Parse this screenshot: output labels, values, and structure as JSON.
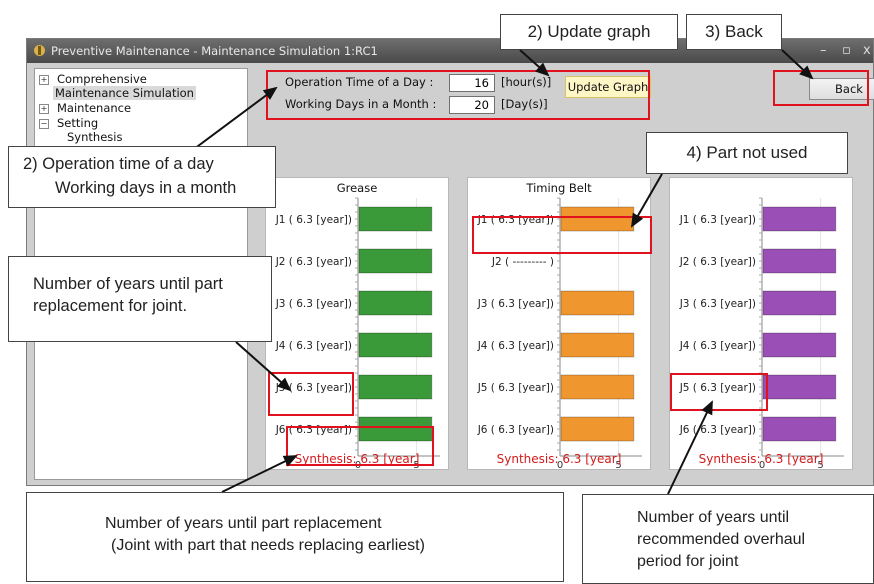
{
  "window": {
    "title": "Preventive Maintenance - Maintenance Simulation 1:RC1",
    "controls": [
      "–",
      "▫",
      "x"
    ]
  },
  "tree": {
    "items": [
      {
        "label": "Comprehensive",
        "expand": "+"
      },
      {
        "label": "Maintenance Simulation"
      },
      {
        "label": "Maintenance",
        "expand": "+"
      },
      {
        "label": "Setting",
        "expand": "−"
      },
      {
        "label": "Synthesis"
      }
    ]
  },
  "form": {
    "operation_time_label": "Operation Time of a Day :",
    "operation_time_value": "16",
    "operation_time_unit": "[hour(s)]",
    "working_days_label": "Working Days in a Month :",
    "working_days_value": "20",
    "working_days_unit": "[Day(s)]",
    "update_button": "Update Graph",
    "back_button": "Back"
  },
  "charts_axis_ticks": [
    "0",
    "5"
  ],
  "chart_data": [
    {
      "type": "bar",
      "title": "Grease",
      "color": "#3a9a3a",
      "categories": [
        "J1 ( 6.3 [year])",
        "J2 ( 6.3 [year])",
        "J3 ( 6.3 [year])",
        "J4 ( 6.3 [year])",
        "J5 ( 6.3 [year])",
        "J6 ( 6.3 [year])"
      ],
      "values": [
        6.3,
        6.3,
        6.3,
        6.3,
        6.3,
        6.3
      ],
      "xlim": [
        0,
        7
      ],
      "synthesis": "Synthesis: 6.3 [year]"
    },
    {
      "type": "bar",
      "title": "Timing Belt",
      "color": "#f0962e",
      "categories": [
        "J1 ( 6.3 [year])",
        "J2 ( --------- )",
        "J3 ( 6.3 [year])",
        "J4 ( 6.3 [year])",
        "J5 ( 6.3 [year])",
        "J6 ( 6.3 [year])"
      ],
      "values": [
        6.3,
        null,
        6.3,
        6.3,
        6.3,
        6.3
      ],
      "xlim": [
        0,
        7
      ],
      "synthesis": "Synthesis: 6.3 [year]"
    },
    {
      "type": "bar",
      "title": "",
      "color": "#9a4fb6",
      "categories": [
        "J1 ( 6.3 [year])",
        "J2 ( 6.3 [year])",
        "J3 ( 6.3 [year])",
        "J4 ( 6.3 [year])",
        "J5 ( 6.3 [year])",
        "J6 ( 6.3 [year])"
      ],
      "values": [
        6.3,
        6.3,
        6.3,
        6.3,
        6.3,
        6.3
      ],
      "xlim": [
        0,
        7
      ],
      "synthesis": "Synthesis: 6.3 [year]"
    }
  ],
  "callouts": {
    "update_graph": "2) Update graph",
    "back": "3) Back",
    "op_time_line1": "2) Operation time of a day",
    "op_time_line2": "Working days in a month",
    "part_not_used": "4) Part not used",
    "years_joint_line1": "Number of years until part",
    "years_joint_line2": "replacement for joint.",
    "synth_line1": "Number of years until part replacement",
    "synth_line2": "(Joint with part that needs replacing earliest)",
    "overhaul_line1": "Number of years until",
    "overhaul_line2": "recommended overhaul",
    "overhaul_line3": "period for joint"
  }
}
